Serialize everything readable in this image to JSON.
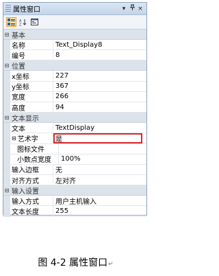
{
  "panel": {
    "title": "属性窗口",
    "title_buttons": [
      "▾",
      "ᵖ",
      "×"
    ]
  },
  "toolbar": {
    "buttons": [
      "categorized-icon",
      "alphabetical-icon",
      "property-pages-icon"
    ]
  },
  "sections": [
    {
      "label": "基本",
      "rows": [
        {
          "name": "名称",
          "value": "Text_Display8"
        },
        {
          "name": "编号",
          "value": "8"
        }
      ]
    },
    {
      "label": "位置",
      "rows": [
        {
          "name": "x坐标",
          "value": "227"
        },
        {
          "name": "y坐标",
          "value": "367"
        },
        {
          "name": "宽度",
          "value": "266"
        },
        {
          "name": "高度",
          "value": "94"
        }
      ]
    },
    {
      "label": "文本显示",
      "rows": [
        {
          "name": "文本",
          "value": "TextDisplay"
        },
        {
          "name": "艺术字",
          "value": "是"
        },
        {
          "name": "图标文件",
          "value": ""
        },
        {
          "name": "小数点宽度",
          "value": "100%"
        },
        {
          "name": "输入边框",
          "value": "无"
        },
        {
          "name": "对齐方式",
          "value": "左对齐"
        }
      ]
    },
    {
      "label": "输入设置",
      "rows": [
        {
          "name": "输入方式",
          "value": "用户主机输入"
        },
        {
          "name": "文本长度",
          "value": "255"
        }
      ]
    }
  ],
  "caption": "图 4-2  属性窗口",
  "caption_mark": "↵"
}
